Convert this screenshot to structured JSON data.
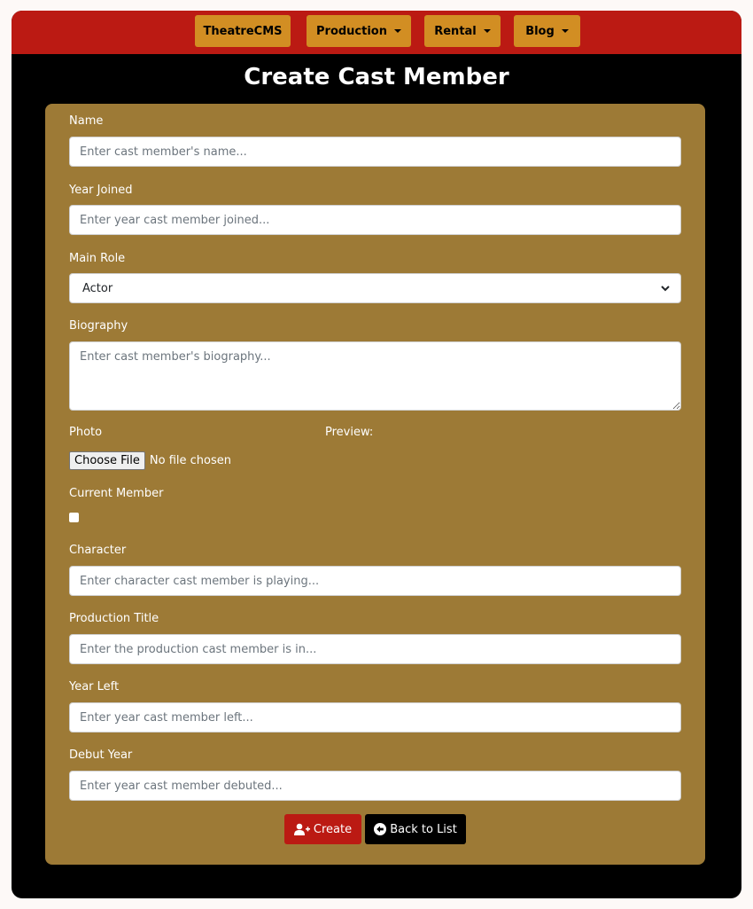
{
  "nav": {
    "brand": "TheatreCMS",
    "production": "Production",
    "rental": "Rental",
    "blog": "Blog"
  },
  "page": {
    "title": "Create Cast Member"
  },
  "form": {
    "name_label": "Name",
    "name_placeholder": "Enter cast member's name...",
    "year_joined_label": "Year Joined",
    "year_joined_placeholder": "Enter year cast member joined...",
    "main_role_label": "Main Role",
    "main_role_value": "Actor",
    "biography_label": "Biography",
    "biography_placeholder": "Enter cast member's biography...",
    "photo_label": "Photo",
    "preview_label": "Preview:",
    "choose_file": "Choose File",
    "no_file": "No file chosen",
    "current_member_label": "Current Member",
    "character_label": "Character",
    "character_placeholder": "Enter character cast member is playing...",
    "production_title_label": "Production Title",
    "production_title_placeholder": "Enter the production cast member is in...",
    "year_left_label": "Year Left",
    "year_left_placeholder": "Enter year cast member left...",
    "debut_year_label": "Debut Year",
    "debut_year_placeholder": "Enter year cast member debuted..."
  },
  "actions": {
    "create": "Create",
    "back": "Back to List"
  },
  "colors": {
    "navbar": "#bb1a13",
    "nav_button": "#d28e23",
    "form_card": "#9d7a36",
    "create_button": "#bb1a13",
    "back_button": "#000000"
  }
}
